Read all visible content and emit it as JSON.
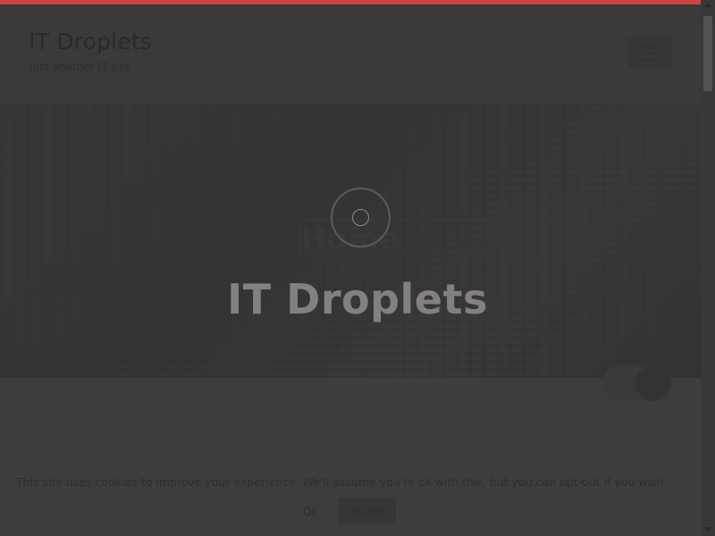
{
  "header": {
    "site_title": "IT Droplets",
    "tagline": "just another IT site",
    "menu_icon": "hamburger-icon"
  },
  "hero": {
    "title": "Home",
    "subtitle": "IT Droplets"
  },
  "cookie_notice": {
    "text": "This site uses cookies to improve your experience. We'll assume you're ok with this, but you can opt-out if you wish.",
    "ok_label": "Ok",
    "accept_label": "Accept"
  },
  "preloader": {
    "title": "IT Droplets",
    "icon": "loading-spinner-icon"
  },
  "colors": {
    "accent": "#e24b4b",
    "overlay": "#3f3f3f",
    "loader_text": "#858080"
  }
}
